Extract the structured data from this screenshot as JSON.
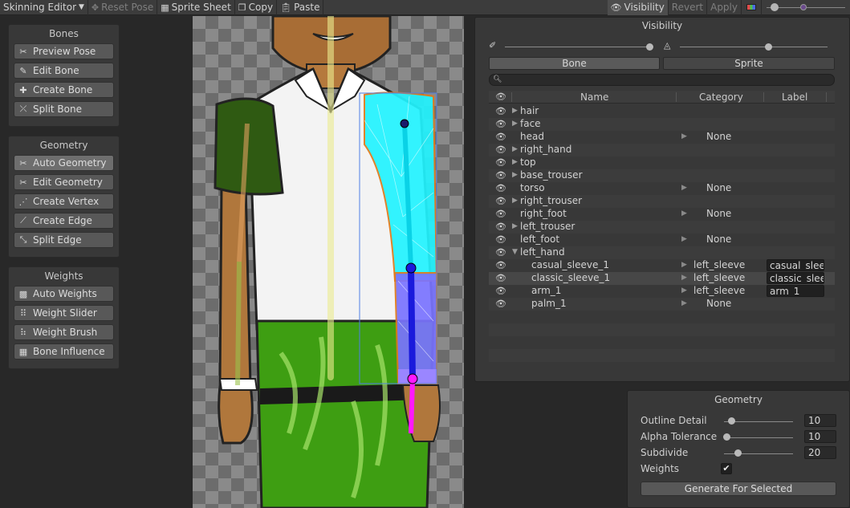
{
  "toolbar": {
    "editor_dropdown": "Skinning Editor",
    "reset_pose": "Reset Pose",
    "sprite_sheet": "Sprite Sheet",
    "copy": "Copy",
    "paste": "Paste",
    "visibility": "Visibility",
    "revert": "Revert",
    "apply": "Apply",
    "zoom_level": 0.1
  },
  "bones_panel": {
    "title": "Bones",
    "buttons": [
      "Preview Pose",
      "Edit Bone",
      "Create Bone",
      "Split Bone"
    ]
  },
  "geometry_tools": {
    "title": "Geometry",
    "buttons": [
      "Auto Geometry",
      "Edit Geometry",
      "Create Vertex",
      "Create Edge",
      "Split Edge"
    ]
  },
  "weights_panel": {
    "title": "Weights",
    "buttons": [
      "Auto Weights",
      "Weight Slider",
      "Weight Brush",
      "Bone Influence"
    ]
  },
  "visibility": {
    "title": "Visibility",
    "bone_opacity": 0.98,
    "sprite_opacity": 0.6,
    "tabs": [
      "Bone",
      "Sprite"
    ],
    "active_tab": "Bone",
    "search": {
      "value": "",
      "placeholder": ""
    },
    "columns": {
      "name": "Name",
      "category": "Category",
      "label": "Label"
    },
    "rows": [
      {
        "name": "hair",
        "expandable": true,
        "indent": 0,
        "category": "",
        "label": ""
      },
      {
        "name": "face",
        "expandable": true,
        "indent": 0,
        "category": "",
        "label": ""
      },
      {
        "name": "head",
        "expandable": false,
        "indent": 0,
        "category": "None",
        "label": ""
      },
      {
        "name": "right_hand",
        "expandable": true,
        "indent": 0,
        "category": "",
        "label": ""
      },
      {
        "name": "top",
        "expandable": true,
        "indent": 0,
        "category": "",
        "label": ""
      },
      {
        "name": "base_trouser",
        "expandable": true,
        "indent": 0,
        "category": "",
        "label": ""
      },
      {
        "name": "torso",
        "expandable": false,
        "indent": 0,
        "category": "None",
        "label": ""
      },
      {
        "name": "right_trouser",
        "expandable": true,
        "indent": 0,
        "category": "",
        "label": ""
      },
      {
        "name": "right_foot",
        "expandable": false,
        "indent": 0,
        "category": "None",
        "label": ""
      },
      {
        "name": "left_trouser",
        "expandable": true,
        "indent": 0,
        "category": "",
        "label": ""
      },
      {
        "name": "left_foot",
        "expandable": false,
        "indent": 0,
        "category": "None",
        "label": ""
      },
      {
        "name": "left_hand",
        "expandable": true,
        "expanded": true,
        "indent": 0,
        "category": "",
        "label": ""
      },
      {
        "name": "casual_sleeve_1",
        "expandable": false,
        "indent": 1,
        "category": "left_sleeve",
        "label": "casual_slee"
      },
      {
        "name": "classic_sleeve_1",
        "expandable": false,
        "indent": 1,
        "category": "left_sleeve",
        "label": "classic_slee",
        "selected": true
      },
      {
        "name": "arm_1",
        "expandable": false,
        "indent": 1,
        "category": "left_sleeve",
        "label": "arm_1"
      },
      {
        "name": "palm_1",
        "expandable": false,
        "indent": 1,
        "category": "None",
        "label": ""
      }
    ]
  },
  "geometry": {
    "title": "Geometry",
    "outline_detail": {
      "label": "Outline Detail",
      "value": "10",
      "fraction": 0.1
    },
    "alpha_tolerance": {
      "label": "Alpha Tolerance",
      "value": "10",
      "fraction": 0.04
    },
    "subdivide": {
      "label": "Subdivide",
      "value": "20",
      "fraction": 0.2
    },
    "weights": {
      "label": "Weights",
      "checked": true
    },
    "generate_label": "Generate For Selected"
  },
  "colors": {
    "panel_bg": "#383838",
    "window_bg": "#282828",
    "shirt": "#f5f5f5",
    "skin": "#b5793d",
    "sleeve_green": "#2f5a12",
    "trouser_green": "#3e9e12",
    "mesh_cyan": "#22f4ff",
    "mesh_blue": "#7a74ff",
    "bone_magenta": "#ff18ff"
  }
}
